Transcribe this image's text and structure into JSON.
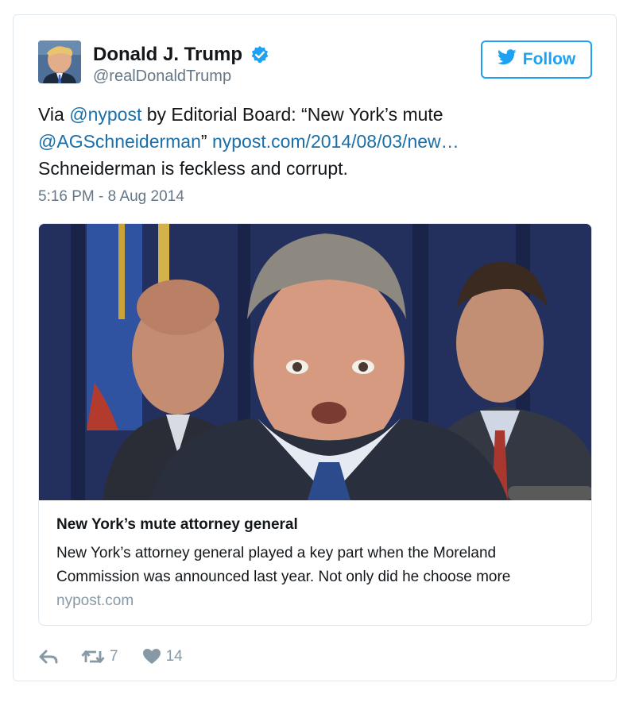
{
  "author": {
    "name": "Donald J. Trump",
    "handle": "@realDonaldTrump",
    "verified": true
  },
  "follow_label": "Follow",
  "tweet": {
    "text_via": "Via ",
    "mention_nypost": "@nypost",
    "text_editorial": " by Editorial Board: “New York’s mute",
    "mention_ag": "@AGSchneiderman",
    "text_quote_close": "” ",
    "link": "nypost.com/2014/08/03/new…",
    "line3": "Schneiderman is feckless and corrupt.",
    "timestamp": "5:16 PM - 8 Aug 2014"
  },
  "link_card": {
    "title": "New York’s mute attorney general",
    "desc_line1": "New York’s attorney general played a key part when the Moreland",
    "desc_line2": "Commission was announced last year. Not only did he choose more",
    "domain": "nypost.com"
  },
  "actions": {
    "retweets": "7",
    "likes": "14"
  },
  "colors": {
    "brand_blue": "#1da1f2",
    "link_blue": "#1b6fa8",
    "muted_gray": "#657786",
    "border": "#e1e8ed"
  },
  "icons": [
    "twitter-bird-icon",
    "verified-badge-icon",
    "reply-icon",
    "retweet-icon",
    "heart-icon"
  ]
}
